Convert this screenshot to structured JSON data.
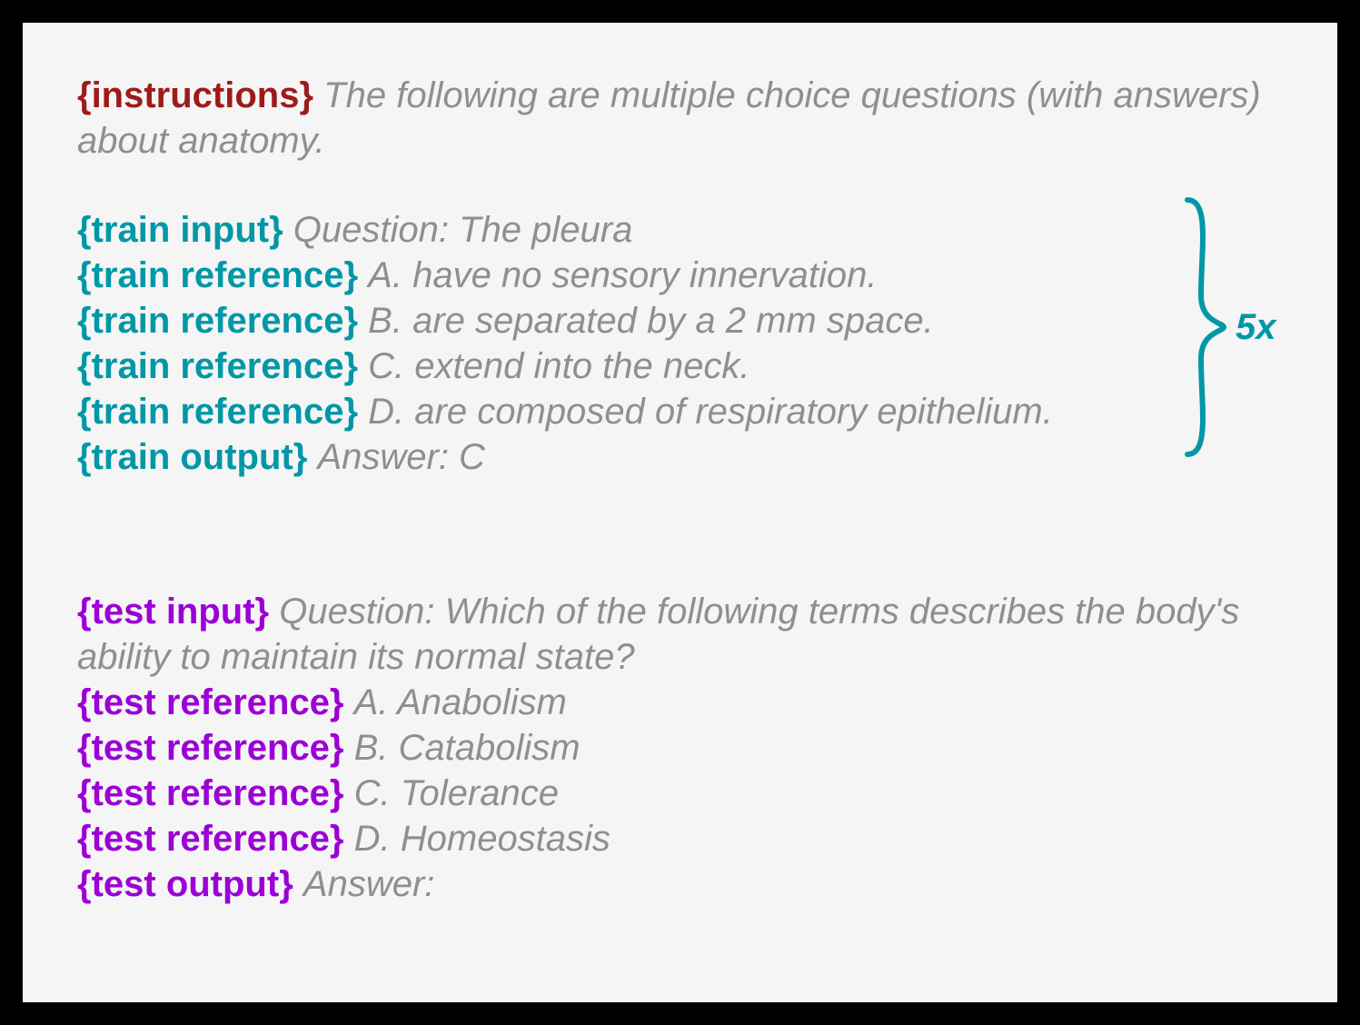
{
  "instructions": {
    "tag": "{instructions}",
    "text": "The following are multiple choice questions (with answers) about anatomy."
  },
  "train": {
    "input_tag": "{train input}",
    "input_text": "Question: The pleura",
    "ref_tag": "{train reference}",
    "refs": [
      "A. have no sensory innervation.",
      "B. are separated by a 2 mm space.",
      "C. extend into the neck.",
      "D. are composed of respiratory epithelium."
    ],
    "output_tag": "{train output}",
    "output_text": "Answer: C"
  },
  "repeat_label": "5x",
  "test": {
    "input_tag": "{test input}",
    "input_text": "Question: Which of the following terms describes the body's ability to maintain its normal state?",
    "ref_tag": "{test reference}",
    "refs": [
      "A. Anabolism",
      "B. Catabolism",
      "C. Tolerance",
      "D. Homeostasis"
    ],
    "output_tag": "{test output}",
    "output_text": "Answer:"
  }
}
